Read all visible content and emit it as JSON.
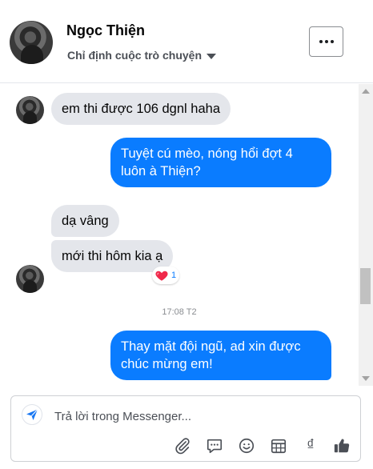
{
  "header": {
    "contact_name": "Ngọc Thiện",
    "assign_label": "Chỉ định cuộc trò chuyện",
    "more_icon": "more-horizontal-icon"
  },
  "thread": {
    "messages": [
      {
        "direction": "incoming",
        "text": "em thi được 106 dgnl haha"
      },
      {
        "direction": "outgoing",
        "text_line1": "Tuyệt cú mèo, nóng hổi đợt 4",
        "text_line2": "luôn à Thiện?"
      },
      {
        "direction": "incoming",
        "text": "dạ vâng"
      },
      {
        "direction": "incoming",
        "text": "mới thi hôm kia ạ",
        "reaction": {
          "emoji": "heart",
          "count": "1"
        }
      },
      {
        "direction": "outgoing",
        "text_line1": "Thay mặt đội ngũ, ad xin được",
        "text_line2": "chúc mừng em!"
      }
    ],
    "timestamp": "17:08 T2"
  },
  "composer": {
    "placeholder": "Trả lời trong Messenger...",
    "value": "",
    "tools": [
      "paperclip-icon",
      "chat-bubble-icon",
      "emoji-icon",
      "calendar-icon",
      "currency-dong-icon",
      "thumbs-up-icon"
    ],
    "currency_symbol": "₫"
  },
  "colors": {
    "outgoing_bubble": "#0a7cff",
    "incoming_bubble": "#e4e6eb",
    "like_icon": "#4b4f56"
  }
}
